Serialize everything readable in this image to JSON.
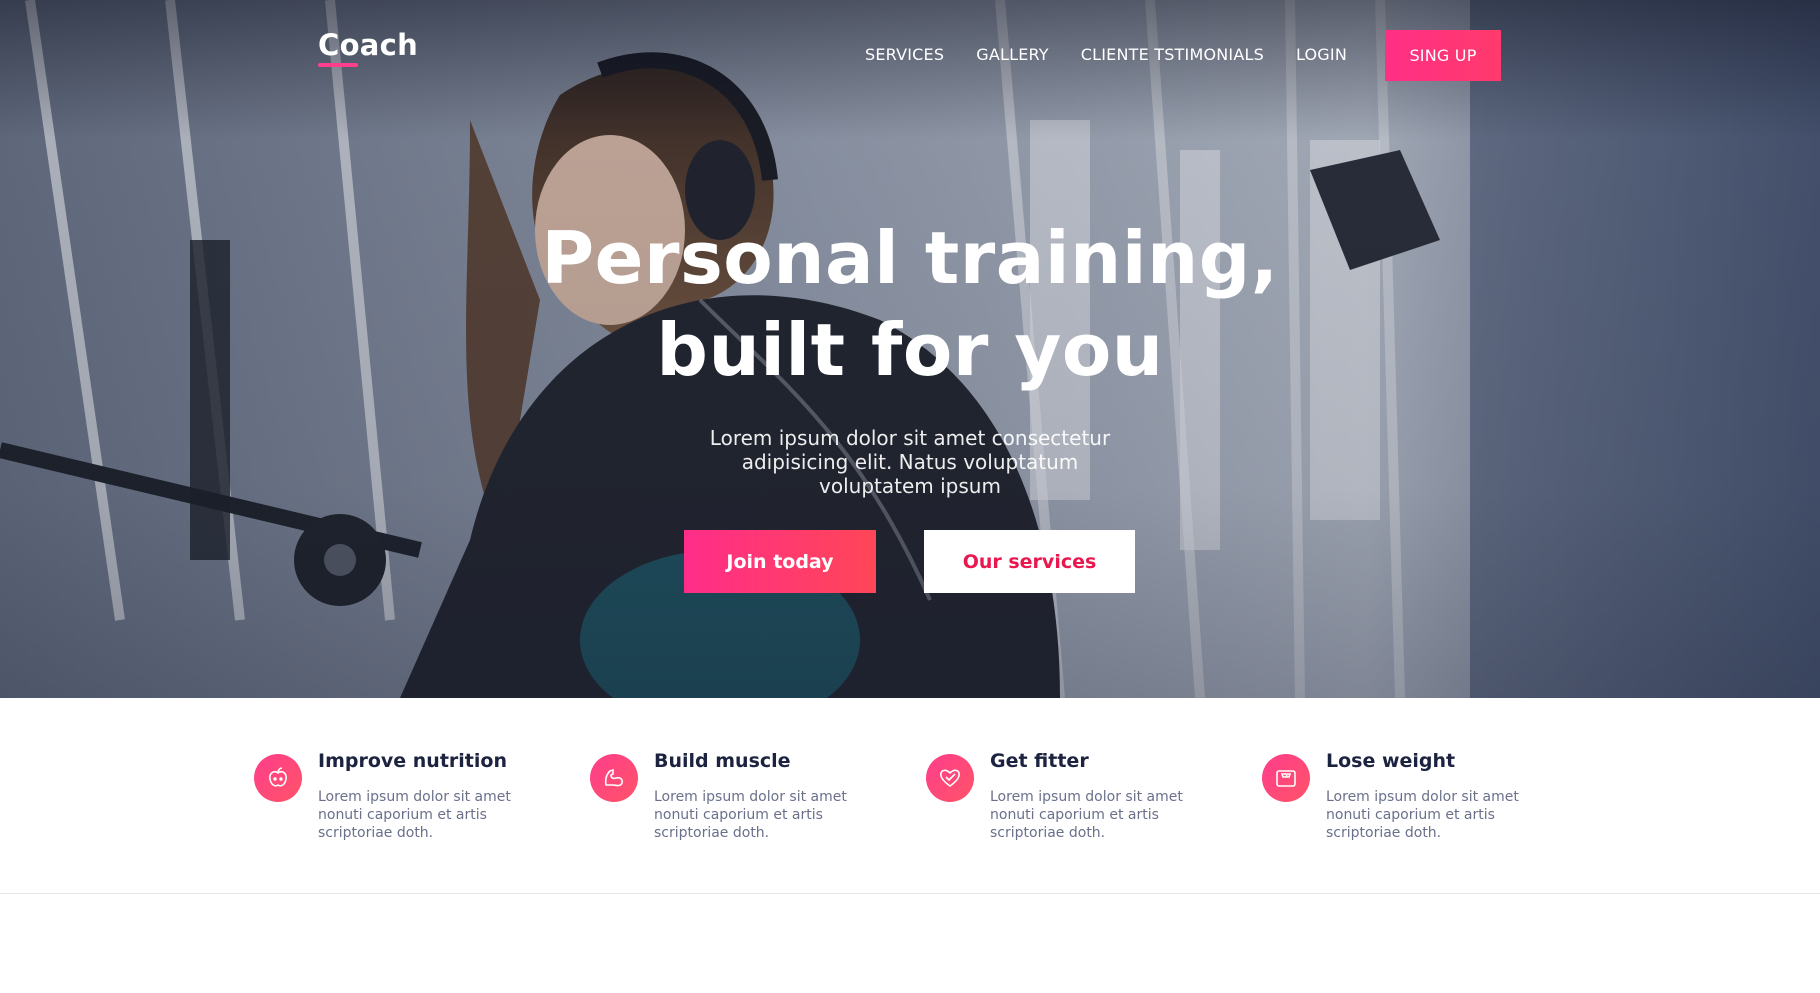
{
  "brand": {
    "name": "Coach",
    "accent": "#ff3f8c",
    "accent_gradient_end": "#ff4657"
  },
  "nav": {
    "links": [
      {
        "label": "SERVICES"
      },
      {
        "label": "GALLERY"
      },
      {
        "label": "CLIENTE TSTIMONIALS"
      },
      {
        "label": "LOGIN"
      }
    ],
    "signup_label": "SING UP"
  },
  "hero": {
    "title_line1": "Personal training,",
    "title_line2": "built for you",
    "subtitle": "Lorem ipsum dolor sit amet consectetur adipisicing elit. Natus voluptatum voluptatem ipsum",
    "primary_button": "Join today",
    "secondary_button": "Our services",
    "background_image": "woman-with-headphones-in-gym-photo"
  },
  "features": [
    {
      "icon": "apple-icon",
      "title": "Improve nutrition",
      "text": "Lorem ipsum dolor sit amet nonuti caporium et artis scriptoriae doth."
    },
    {
      "icon": "flexed-arm-icon",
      "title": "Build muscle",
      "text": "Lorem ipsum dolor sit amet nonuti caporium et artis scriptoriae doth."
    },
    {
      "icon": "heart-check-icon",
      "title": "Get fitter",
      "text": "Lorem ipsum dolor sit amet nonuti caporium et artis scriptoriae doth."
    },
    {
      "icon": "scale-icon",
      "title": "Lose weight",
      "text": "Lorem ipsum dolor sit amet nonuti caporium et artis scriptoriae doth."
    }
  ]
}
